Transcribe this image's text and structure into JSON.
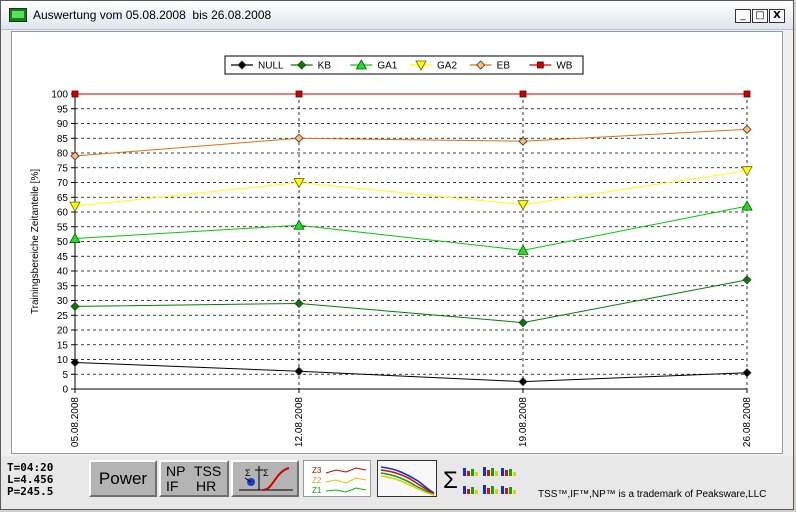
{
  "window": {
    "title": "Auswertung vom 05.08.2008  bis 26.08.2008",
    "controls": {
      "minimize": "_",
      "maximize": "□",
      "close": "X"
    }
  },
  "chart_data": {
    "type": "line",
    "title": "",
    "xlabel": "",
    "ylabel": "Trainingsbereiche Zeitanteile [%]",
    "categories": [
      "05.08.2008",
      "12.08.2008",
      "19.08.2008",
      "26.08.2008"
    ],
    "ylim": [
      0,
      100
    ],
    "yticks": [
      0,
      5,
      10,
      15,
      20,
      25,
      30,
      35,
      40,
      45,
      50,
      55,
      60,
      65,
      70,
      75,
      80,
      85,
      90,
      95,
      100
    ],
    "grid": "horizontal-dashed, vertical-dashed at categories",
    "legend": "top-center",
    "series": [
      {
        "name": "NULL",
        "marker": "diamond",
        "color": "#000000",
        "fill": "#000000",
        "values": [
          9,
          6,
          2.5,
          5.5
        ]
      },
      {
        "name": "KB",
        "marker": "diamond",
        "color": "#008000",
        "fill": "#008000",
        "values": [
          28,
          29,
          22.5,
          37
        ]
      },
      {
        "name": "GA1",
        "marker": "triangle-up",
        "color": "#00cc00",
        "fill": "#22dd22",
        "values": [
          51,
          55.5,
          47,
          62
        ]
      },
      {
        "name": "GA2",
        "marker": "triangle-down",
        "color": "#ffff00",
        "fill": "#ffff00",
        "values": [
          62,
          70,
          62.5,
          74
        ]
      },
      {
        "name": "EB",
        "marker": "diamond",
        "color": "#e07010",
        "fill": "#ffbb77",
        "values": [
          79,
          85,
          84,
          88
        ]
      },
      {
        "name": "WB",
        "marker": "square",
        "color": "#cc0000",
        "fill": "#cc0000",
        "values": [
          100,
          100,
          100,
          100
        ]
      }
    ]
  },
  "footer": {
    "stats": [
      "T=04:20",
      "L=4.456",
      "P=245.5"
    ],
    "power_button": "Power",
    "metrics_button": {
      "np": "NP",
      "tss": "TSS",
      "if": "IF",
      "hr": "HR"
    },
    "zone_labels": [
      "Z3",
      "Z2",
      "Z1"
    ],
    "trademark": "TSS™,IF™,NP™ is a trademark of Peaksware,LLC"
  }
}
